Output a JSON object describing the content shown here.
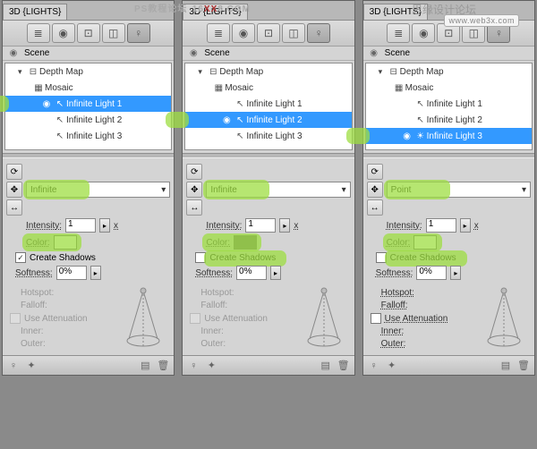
{
  "watermark": {
    "left": "PS教程论坛",
    "center_a": "16",
    "center_b": "XX",
    "center_c": "8.COM",
    "cn": "思缘设计论坛",
    "box": "www.web3x.com"
  },
  "tab_title": "3D {LIGHTS}",
  "icons": {
    "layers": "≣",
    "sphere": "◉",
    "cyl": "⊡",
    "mesh": "◫",
    "bulb": "♀"
  },
  "scene": {
    "title": "Scene",
    "depth": "Depth Map",
    "mosaic": "Mosaic",
    "lights": [
      "Infinite Light 1",
      "Infinite Light 2",
      "Infinite Light 3"
    ]
  },
  "props": {
    "type_infinite": "Infinite",
    "type_point": "Point",
    "intensity": "Intensity:",
    "intensity_val": "1",
    "x_label": "x",
    "color": "Color:",
    "create_shadows": "Create Shadows",
    "softness": "Softness:",
    "softness_val": "0%",
    "hotspot": "Hotspot:",
    "falloff": "Falloff:",
    "use_attn": "Use Attenuation",
    "inner": "Inner:",
    "outer": "Outer:"
  },
  "panels": [
    {
      "selected": 0,
      "type": "Infinite",
      "color": "#ffffff",
      "shadows": true,
      "shadows_hl": false,
      "attn_disabled": true
    },
    {
      "selected": 1,
      "type": "Infinite",
      "color": "#6a6a6a",
      "shadows": false,
      "shadows_hl": true,
      "attn_disabled": true
    },
    {
      "selected": 2,
      "type": "Point",
      "color": "#ffffff",
      "shadows": false,
      "shadows_hl": true,
      "attn_disabled": false
    }
  ]
}
